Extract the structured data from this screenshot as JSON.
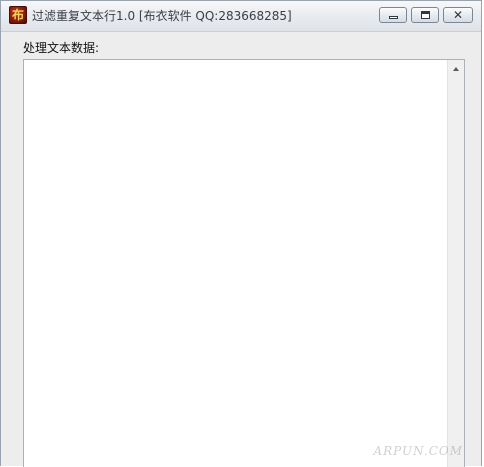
{
  "window": {
    "title": "过滤重复文本行1.0 [布衣软件 QQ:283668285]",
    "icon_glyph": "布",
    "icon_name": "app-logo-icon",
    "controls": {
      "minimize_icon": "minimize-icon",
      "maximize_icon": "maximize-icon",
      "close_icon": "close-icon",
      "close_glyph": "✕"
    }
  },
  "main": {
    "field_label": "处理文本数据:",
    "textarea_value": ""
  },
  "watermark": "ARPUN.COM",
  "colors": {
    "icon_red": "#7a1408",
    "icon_gold": "#f6d35a",
    "window_bg": "#ededed",
    "textarea_bg": "#ffffff"
  }
}
